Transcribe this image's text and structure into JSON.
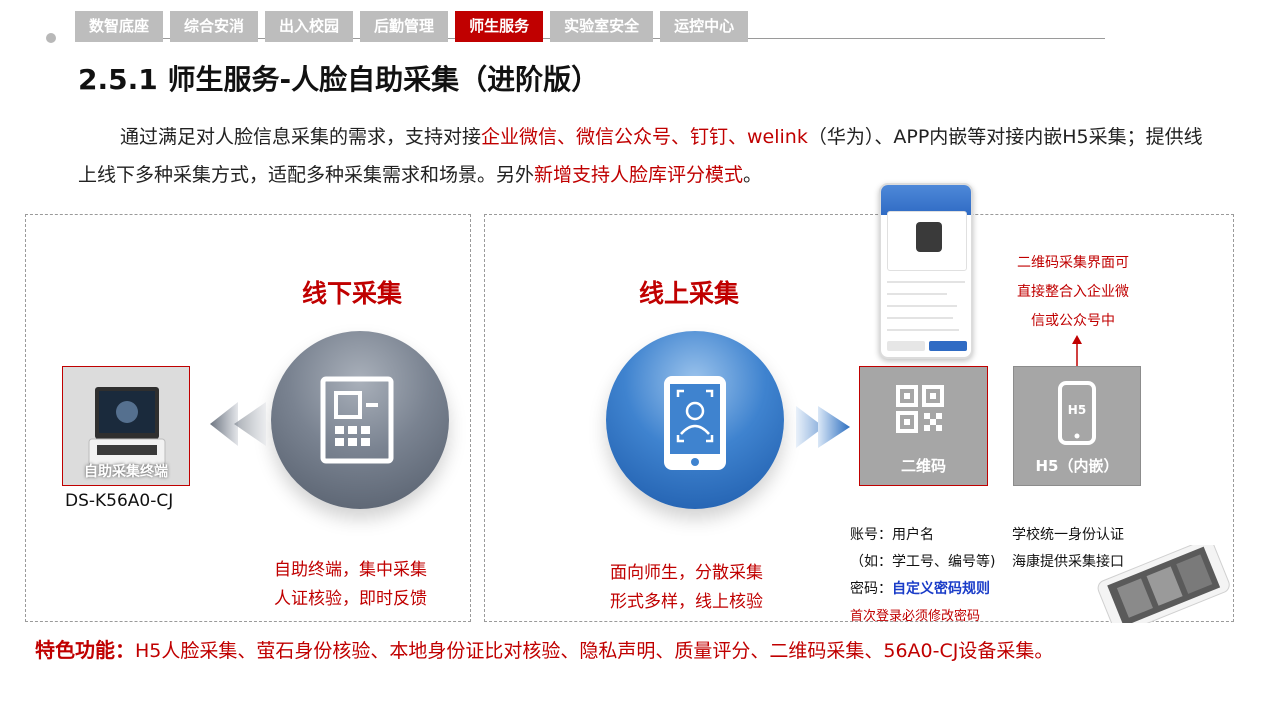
{
  "nav": {
    "tabs": [
      {
        "label": "数智底座",
        "active": false
      },
      {
        "label": "综合安消",
        "active": false
      },
      {
        "label": "出入校园",
        "active": false
      },
      {
        "label": "后勤管理",
        "active": false
      },
      {
        "label": "师生服务",
        "active": true
      },
      {
        "label": "实验室安全",
        "active": false
      },
      {
        "label": "运控中心",
        "active": false
      }
    ]
  },
  "page": {
    "title": "2.5.1 师生服务-人脸自助采集（进阶版）",
    "intro": {
      "part1": "通过满足对人脸信息采集的需求，支持对接",
      "highlight1": "企业微信、微信公众号、钉钉、welink",
      "part2": "（华为）、APP内嵌等对接内嵌H5采集；提供线上线下多种采集方式，适配多种采集需求和场景。另外",
      "highlight2": "新增支持人脸库评分模式",
      "part3": "。"
    }
  },
  "offline": {
    "heading": "线下采集",
    "terminal_label": "自助采集终端",
    "model": "DS-K56A0-CJ",
    "caption_line1": "自助终端，集中采集",
    "caption_line2": "人证核验，即时反馈"
  },
  "online": {
    "heading": "线上采集",
    "caption_line1": "面向师生，分散采集",
    "caption_line2": "形式多样，线上核验",
    "qr_label": "二维码",
    "h5_label": "H5（内嵌）",
    "h5_icon_text": "H5",
    "qr_note_line1": "二维码采集界面可",
    "qr_note_line2": "直接整合入企业微",
    "qr_note_line3": "信或公众号中",
    "account_line": "账号：用户名",
    "account_example": "（如：学工号、编号等)",
    "password_prefix": "密码：",
    "password_rule": "自定义密码规则",
    "password_notice": "首次登录必须修改密码",
    "unified_auth": "学校统一身份认证",
    "hik_api": "海康提供采集接口"
  },
  "footer": {
    "label": "特色功能：",
    "text": "H5人脸采集、萤石身份核验、本地身份证比对核验、隐私声明、质量评分、二维码采集、56A0-CJ设备采集。"
  },
  "colors": {
    "accent": "#c00000",
    "tab_inactive": "#bdbdbd",
    "link_blue": "#1a3cc8"
  }
}
